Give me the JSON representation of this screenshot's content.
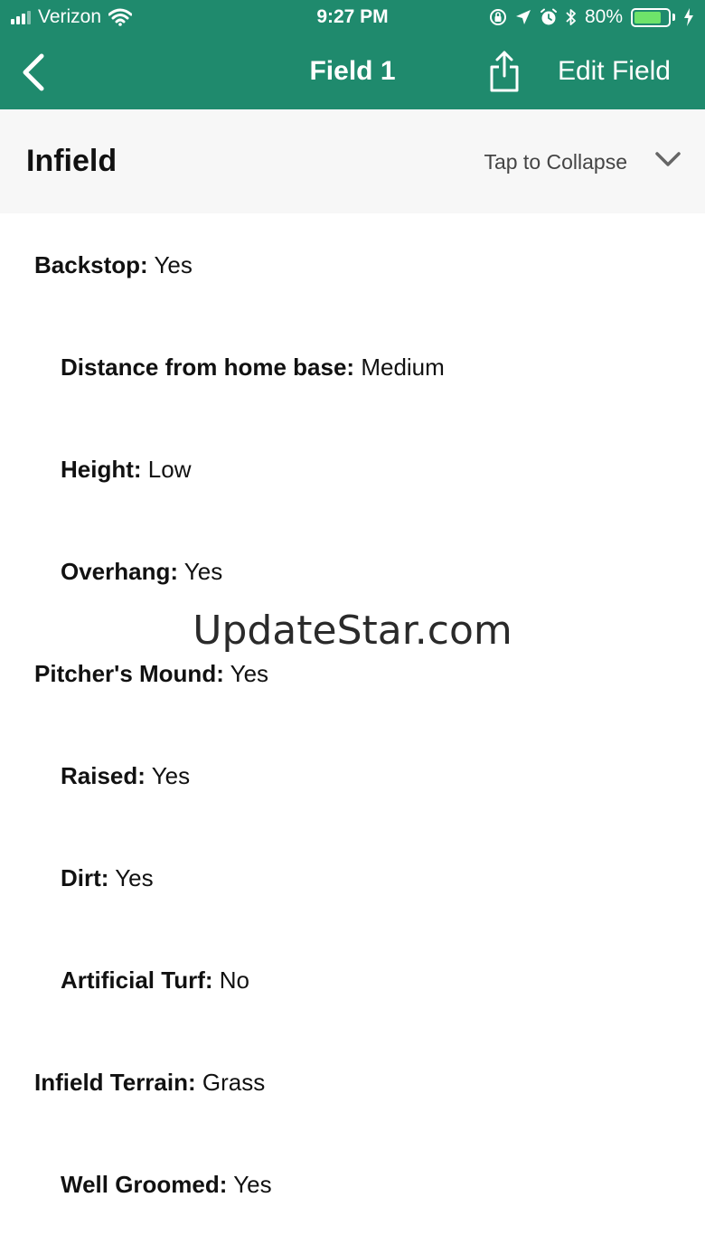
{
  "status_bar": {
    "carrier": "Verizon",
    "time": "9:27 PM",
    "battery_percent": "80%",
    "battery_level": 0.8,
    "icons": [
      "signal-icon",
      "wifi-icon",
      "rotation-lock-icon",
      "location-icon",
      "alarm-icon",
      "bluetooth-icon",
      "battery-icon",
      "charging-icon"
    ]
  },
  "nav": {
    "title": "Field 1",
    "edit_label": "Edit Field",
    "back_icon": "chevron-left-icon",
    "share_icon": "share-icon"
  },
  "section": {
    "title": "Infield",
    "collapse_label": "Tap to Collapse",
    "collapse_icon": "chevron-down-icon"
  },
  "rows": [
    {
      "label": "Backstop:",
      "value": "Yes",
      "level": 0
    },
    {
      "label": "Distance from home base:",
      "value": "Medium",
      "level": 1
    },
    {
      "label": "Height:",
      "value": "Low",
      "level": 1
    },
    {
      "label": "Overhang:",
      "value": "Yes",
      "level": 1
    },
    {
      "label": "Pitcher's Mound:",
      "value": "Yes",
      "level": 0
    },
    {
      "label": "Raised:",
      "value": "Yes",
      "level": 1
    },
    {
      "label": "Dirt:",
      "value": "Yes",
      "level": 1
    },
    {
      "label": "Artificial Turf:",
      "value": "No",
      "level": 1
    },
    {
      "label": "Infield Terrain:",
      "value": "Grass",
      "level": 0
    },
    {
      "label": "Well Groomed:",
      "value": "Yes",
      "level": 1
    }
  ],
  "watermark": "UpdateStar.com",
  "colors": {
    "header_green": "#1f8a6d",
    "section_bg": "#f7f7f7",
    "battery_green": "#6ee36a"
  }
}
